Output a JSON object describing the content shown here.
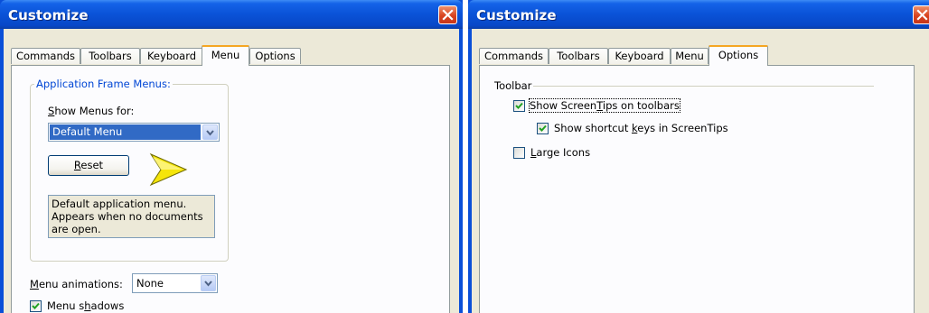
{
  "left_window": {
    "title": "Customize",
    "tabs": [
      {
        "label": "Commands",
        "active": false
      },
      {
        "label": "Toolbars",
        "active": false
      },
      {
        "label": "Keyboard",
        "active": false
      },
      {
        "label": "Menu",
        "active": true
      },
      {
        "label": "Options",
        "active": false
      }
    ],
    "group_label": "Application Frame Menus:",
    "show_menus_pre": "S",
    "show_menus_rest": "how Menus for:",
    "show_menus_value": "Default Menu",
    "reset_pre": "R",
    "reset_rest": "eset",
    "description_lines": [
      "Default application menu.",
      "Appears when no documents",
      "are open."
    ],
    "menu_animations_pre": "M",
    "menu_animations_rest": "enu animations:",
    "menu_animations_value": "None",
    "menu_shadows_pre": "Menu s",
    "menu_shadows_u": "h",
    "menu_shadows_rest": "adows",
    "menu_shadows_checked": true
  },
  "right_window": {
    "title": "Customize",
    "tabs": [
      {
        "label": "Commands",
        "active": false
      },
      {
        "label": "Toolbars",
        "active": false
      },
      {
        "label": "Keyboard",
        "active": false
      },
      {
        "label": "Menu",
        "active": false
      },
      {
        "label": "Options",
        "active": true
      }
    ],
    "section_label": "Toolbar",
    "screentips_pre": "Show Screen",
    "screentips_u": "T",
    "screentips_rest": "ips on toolbars",
    "screentips_checked": true,
    "shortcut_pre": "Show shortcut ",
    "shortcut_u": "k",
    "shortcut_rest": "eys in ScreenTips",
    "shortcut_checked": true,
    "large_icons_u": "L",
    "large_icons_rest": "arge Icons",
    "large_icons_checked": false
  },
  "colors": {
    "titlebar": "#0a52d7",
    "selection": "#316ac5",
    "group_label": "#0046d5",
    "arrow": "#f5e50a"
  }
}
